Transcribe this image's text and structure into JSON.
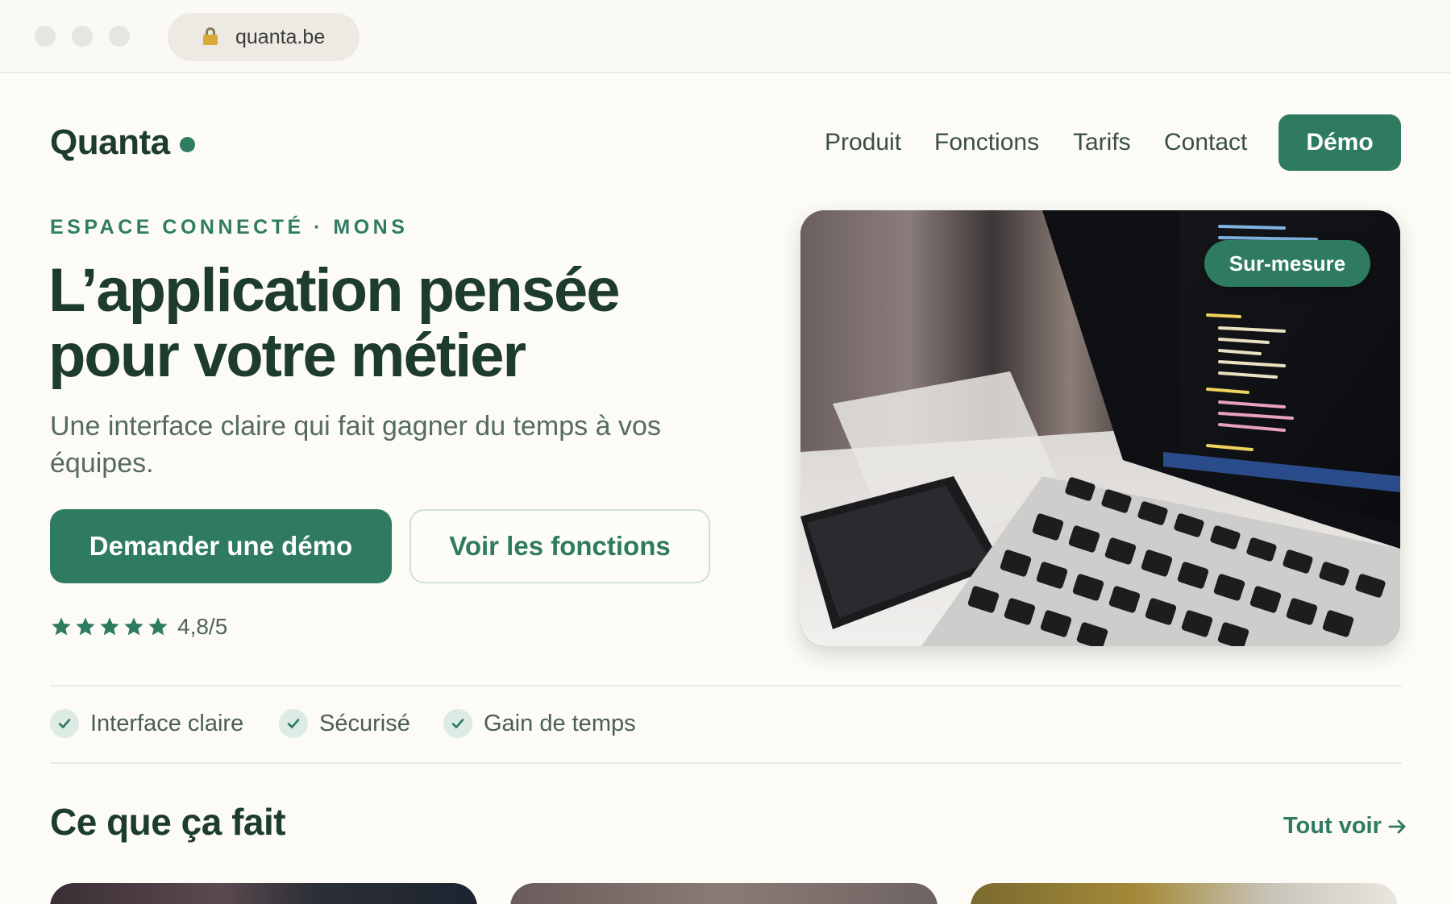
{
  "browser": {
    "url": "quanta.be"
  },
  "nav": {
    "logo": "Quanta",
    "links": [
      "Produit",
      "Fonctions",
      "Tarifs",
      "Contact"
    ],
    "cta": "Démo"
  },
  "hero": {
    "eyebrow": "ESPACE CONNECTÉ · MONS",
    "title": "L’application pensée pour votre métier",
    "subtitle": "Une interface claire qui fait gagner du temps à vos équipes.",
    "primary_button": "Demander une démo",
    "secondary_button": "Voir les fonctions",
    "rating": {
      "stars": 5,
      "text": "4,8/5"
    },
    "image_badge": "Sur-mesure"
  },
  "features": [
    "Interface claire",
    "Sécurisé",
    "Gain de temps"
  ],
  "section": {
    "title": "Ce que ça fait",
    "see_all": "Tout voir"
  },
  "colors": {
    "accent": "#2e7b62",
    "dark_text": "#1d3b2f",
    "background": "#fcfbf5"
  }
}
